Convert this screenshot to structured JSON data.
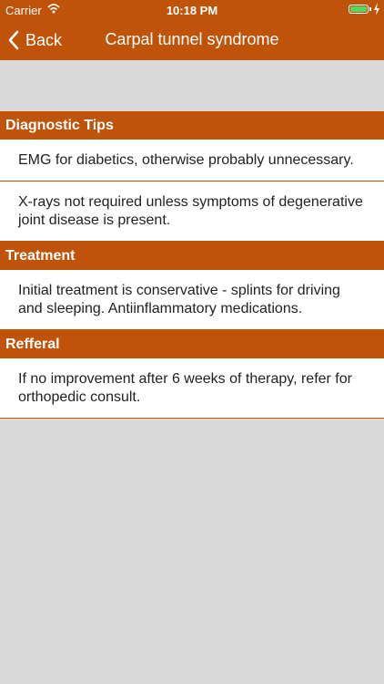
{
  "status": {
    "carrier": "Carrier",
    "time": "10:18 PM",
    "battery_level": 1.0
  },
  "nav": {
    "back_label": "Back",
    "title": "Carpal tunnel syndrome"
  },
  "sections": [
    {
      "title": "Diagnostic Tips",
      "items": [
        "EMG for diabetics, otherwise probably unnecessary.",
        "X-rays not required unless symptoms of degenerative joint disease is present."
      ]
    },
    {
      "title": "Treatment",
      "items": [
        "Initial treatment is conservative - splints for driving and sleeping. Antiinflammatory medications."
      ]
    },
    {
      "title": "Refferal",
      "items": [
        "If no improvement after 6 weeks of therapy, refer for orthopedic consult."
      ]
    }
  ],
  "colors": {
    "accent": "#bf5309",
    "background": "#d9d9d9",
    "battery": "#4cd964"
  }
}
